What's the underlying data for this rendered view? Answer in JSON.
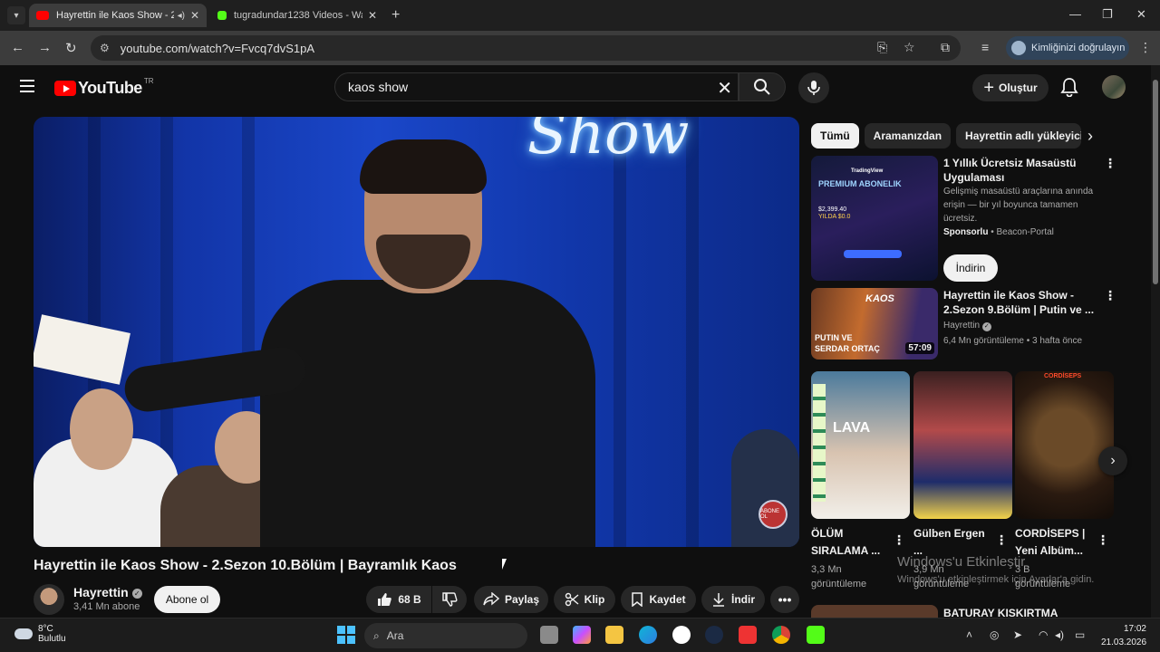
{
  "browser": {
    "tabs": [
      {
        "title": "Hayrettin ile Kaos Show - 2.",
        "active": true
      },
      {
        "title": "tugradundar1238 Videos - Wat",
        "active": false
      }
    ],
    "url": "youtube.com/watch?v=Fvcq7dvS1pA",
    "profile_label": "Kimliğinizi doğrulayın"
  },
  "header": {
    "logo": "YouTube",
    "region": "TR",
    "search_value": "kaos show",
    "create_label": "Oluştur"
  },
  "player": {
    "neon_text": "Show",
    "badge": "ABONE OL"
  },
  "video": {
    "title": "Hayrettin ile Kaos Show - 2.Sezon 10.Bölüm | Bayramlık Kaos",
    "channel": "Hayrettin",
    "subscribers": "3,41 Mn abone",
    "subscribe_label": "Abone ol",
    "likes": "68 B",
    "share_label": "Paylaş",
    "clip_label": "Klip",
    "save_label": "Kaydet",
    "download_label": "İndir"
  },
  "sidebar": {
    "chips": [
      "Tümü",
      "Aramanızdan",
      "Hayrettin adlı yükleyiciden"
    ],
    "ad": {
      "title": "1 Yıllık Ücretsiz Masaüstü Uygulaması",
      "description": "Gelişmiş masaüstü araçlarına anında erişin — bir yıl boyunca tamamen ücretsiz.",
      "sponsor_label": "Sponsorlu",
      "advertiser": "Beacon-Portal",
      "button": "İndirin",
      "thumb_brand": "TradingView",
      "thumb_headline": "PREMIUM ABONELIK",
      "thumb_price": "$2,399.40",
      "thumb_price2": "YILDA $0.0"
    },
    "recommended": {
      "title": "Hayrettin ile Kaos Show - 2.Sezon 9.Bölüm | Putin ve ...",
      "channel": "Hayrettin",
      "meta": "6,4 Mn görüntüleme • 3 hafta önce",
      "duration": "57:09",
      "thumb_label1": "PUTIN VE",
      "thumb_label2": "SERDAR ORTAÇ",
      "thumb_brand": "KAOS"
    },
    "shorts": [
      {
        "title": "ÖLÜM SIRALAMA ...",
        "views": "3,3 Mn görüntüleme",
        "thumb_text": "LAVA"
      },
      {
        "title": "Gülben Ergen ...",
        "views": "3,9 Mn görüntüleme",
        "thumb_text": ""
      },
      {
        "title": "CORDİSEPS | Yeni Albüm...",
        "views": "3 B görüntüleme",
        "thumb_text": "CORDİSEPS"
      }
    ],
    "next_title": "BATURAY KISKIRTMA"
  },
  "watermark": {
    "line1": "Windows'u Etkinleştir",
    "line2": "Windows'u etkinleştirmek için Ayarlar'a gidin."
  },
  "taskbar": {
    "temperature": "8°C",
    "condition": "Bulutlu",
    "search_placeholder": "Ara",
    "time": "17:02",
    "date": "21.03.2026"
  }
}
